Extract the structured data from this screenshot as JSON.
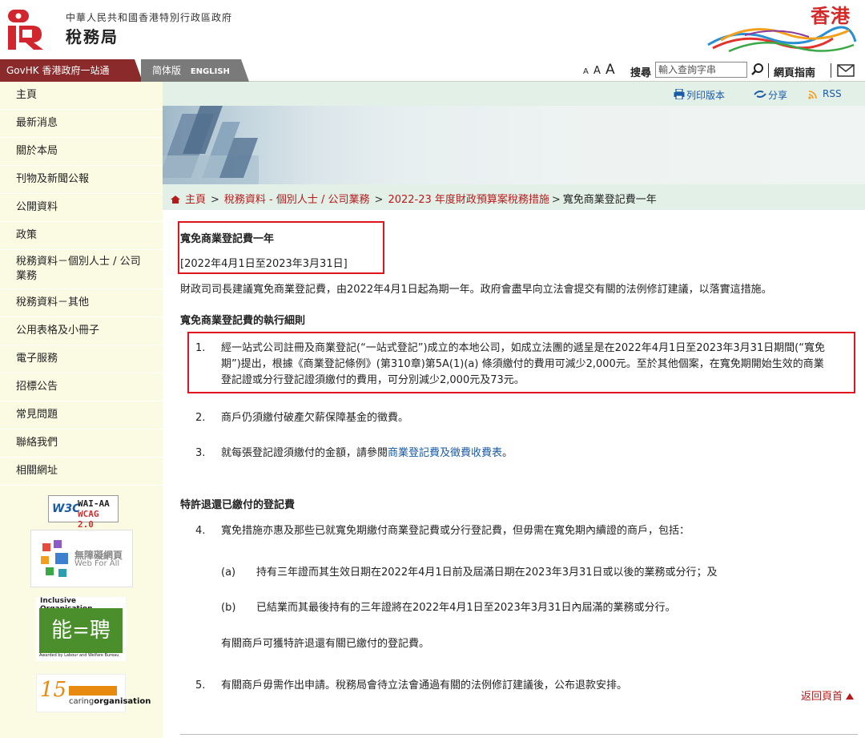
{
  "header": {
    "government": "中華人民共和國香港特別行政區政府",
    "department": "稅務局",
    "brand": "香港"
  },
  "nav": {
    "govhk": "GovHK 香港政府一站通",
    "simplified": "简体版",
    "english": "ENGLISH",
    "font_small": "A",
    "font_medium": "A",
    "font_large": "A",
    "search_label": "搜尋",
    "search_placeholder": "輸入查詢字串",
    "sitemap": "網頁指南"
  },
  "sidebar": {
    "items": [
      "主頁",
      "最新消息",
      "關於本局",
      "刊物及新聞公報",
      "公開資料",
      "政策",
      "稅務資料－個別人士 / 公司業務",
      "稅務資料－其他",
      "公用表格及小冊子",
      "電子服務",
      "招標公告",
      "常見問題",
      "聯絡我們",
      "相關網址"
    ],
    "badges": {
      "w3c": "W3C",
      "wai": "WAI-AA",
      "wcag": "WCAG 2.0",
      "wfa_cn": "無障礙網頁",
      "wfa_en": "Web For All",
      "inclusive": "Inclusive Organisation",
      "inclusive_award": "Awarded by Labour and Welfare Bureau",
      "caring_num": "15",
      "caring_text_pre": "caring",
      "caring_text_bold": "organisation"
    }
  },
  "utility": {
    "print": "列印版本",
    "share": "分享",
    "rss": "RSS"
  },
  "breadcrumb": {
    "home": "主頁",
    "level1": "稅務資料 - 個別人士 / 公司業務",
    "level2": "2022-23 年度財政預算案稅務措施",
    "current": "寬免商業登記費一年"
  },
  "content": {
    "title": "寬免商業登記費一年",
    "period": "[2022年4月1日至2023年3月31日]",
    "intro": "財政司司長建議寬免商業登記費，由2022年4月1日起為期一年。政府會盡早向立法會提交有關的法例修訂建議，以落實這措施。",
    "section1_heading": "寬免商業登記費的執行細則",
    "item1_num": "1.",
    "item1_line1": "經一站式公司註冊及商業登記(“一站式登記”)成立的本地公司，如成立法團的遞呈是在2022年4月1日至2023年3月31日期間(“寬免",
    "item1_line2": "期”)提出，根據《商業登記條例》(第310章)第5A(1)(a) 條須繳付的費用可減少2,000元。至於其他個案，在寬免期開始生效的商業",
    "item1_line3": "登記證或分行登記證須繳付的費用，可分別減少2,000元及73元。",
    "item2_num": "2.",
    "item2": "商戶仍須繳付破產欠薪保障基金的徵費。",
    "item3_num": "3.",
    "item3_pre": "就每張登記證須繳付的金額，請參閱",
    "item3_link": "商業登記費及徵費收費表",
    "item3_post": "。",
    "section2_heading": "特許退還已繳付的登記費",
    "item4_num": "4.",
    "item4": "寬免措施亦惠及那些已就寬免期繳付商業登記費或分行登記費，但毋需在寬免期內續證的商戶，包括：",
    "item4a_num": "(a)",
    "item4a": "持有三年證而其生效日期在2022年4月1日前及屆滿日期在2023年3月31日或以後的業務或分行；及",
    "item4b_num": "(b)",
    "item4b": "已結業而其最後持有的三年證將在2022年4月1日至2023年3月31日內屆滿的業務或分行。",
    "item4_note": "有關商戶可獲特許退還有關已繳付的登記費。",
    "item5_num": "5.",
    "item5": "有關商戶毋需作出申請。稅務局會待立法會通過有關的法例修訂建議後，公布退款安排。",
    "back_to_top": "返回頁首"
  },
  "colors": {
    "brand_red": "#b51b1b",
    "highlight_red": "#e0141e",
    "link_blue": "#1a5aa6",
    "sidebar_bg": "#fbfbe4",
    "band_green": "#e2f0e8"
  }
}
